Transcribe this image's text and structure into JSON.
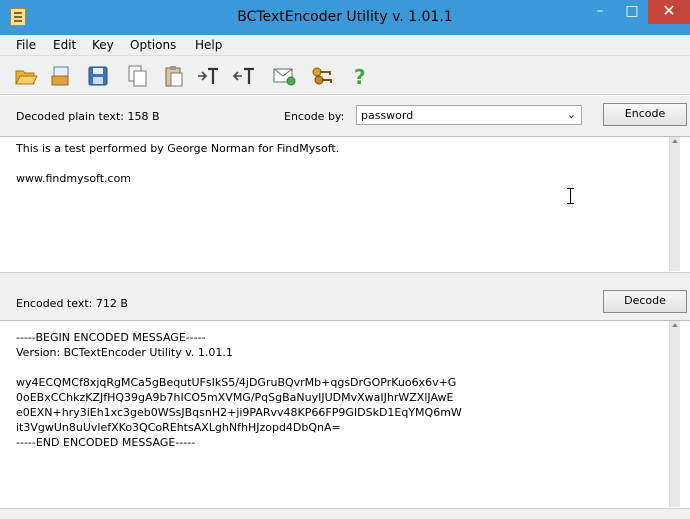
{
  "window": {
    "title": "BCTextEncoder Utility v. 1.01.1",
    "controls": {
      "minimize": "–",
      "maximize": "□",
      "close": "✕"
    },
    "titlebar_color": "#3a9ad9",
    "close_color": "#c7463b"
  },
  "menu": {
    "items": [
      {
        "label": "File"
      },
      {
        "label": "Edit"
      },
      {
        "label": "Key"
      },
      {
        "label": "Options"
      },
      {
        "label": "Help"
      }
    ]
  },
  "toolbar": {
    "icons": [
      "open-folder-icon",
      "open-file-icon",
      "save-icon",
      "copy-icon",
      "paste-icon",
      "encode-text-icon",
      "decode-text-icon",
      "email-icon",
      "key-pair-icon",
      "help-icon"
    ]
  },
  "decoded": {
    "label": "Decoded plain text: 158 B",
    "encode_by_label": "Encode by:",
    "encode_by_value": "password",
    "encode_button": "Encode",
    "lines": [
      "This is a test performed by George Norman for FindMysoft.",
      "",
      "www.findmysoft.com"
    ]
  },
  "encoded": {
    "label": "Encoded text: 712 B",
    "decode_button": "Decode",
    "lines": [
      "-----BEGIN ENCODED MESSAGE-----",
      "Version: BCTextEncoder Utility v. 1.01.1",
      "",
      "wy4ECQMCf8xjqRgMCa5gBequtUFsIkS5/4jDGruBQvrMb+qgsDrGOPrKuo6x6v+G",
      "0oEBxCChkzKZJfHQ39gA9b7hICO5mXVMG/PqSgBaNuyIJUDMvXwaIJhrWZXlJAwE",
      "e0EXN+hry3iEh1xc3geb0WSsJBqsnH2+ji9PARvv48KP66FP9GIDSkD1EqYMQ6mW",
      "it3VgwUn8uUvlefXKo3QCoREhtsAXLghNfhHJzopd4DbQnA=",
      "-----END ENCODED MESSAGE-----"
    ]
  }
}
